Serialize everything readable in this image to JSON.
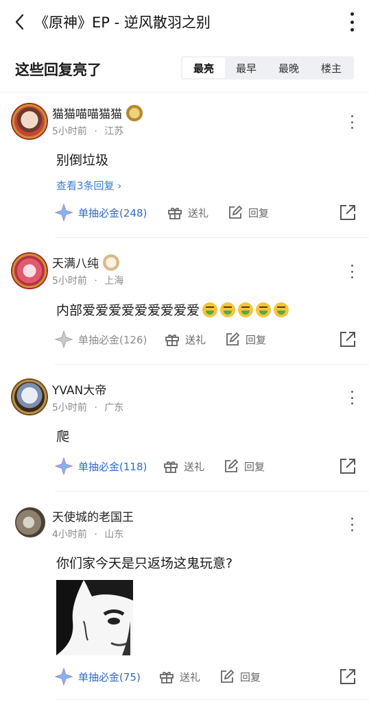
{
  "header": {
    "title": "《原神》EP - 逆风散羽之别"
  },
  "section": {
    "title": "这些回复亮了",
    "sort_tabs": [
      {
        "label": "最亮",
        "active": true
      },
      {
        "label": "最早",
        "active": false
      },
      {
        "label": "最晚",
        "active": false
      },
      {
        "label": "楼主",
        "active": false
      }
    ]
  },
  "comments": [
    {
      "username": "猫猫喵喵猫猫",
      "time": "5小时前",
      "location": "江苏",
      "text": "别倒垃圾",
      "replies_link": "查看3条回复 ›",
      "gold_label": "单抽必金(248)",
      "gift_label": "送礼",
      "reply_label": "回复"
    },
    {
      "username": "天满八纯",
      "time": "5小时前",
      "location": "上海",
      "text": "内部爱爱爱爱爱爱爱爱爱",
      "emoji": "nauseated-face-icon",
      "emoji_count": 5,
      "gold_label": "单抽必金(126)",
      "gift_label": "送礼",
      "reply_label": "回复"
    },
    {
      "username": "YVAN大帝",
      "time": "5小时前",
      "location": "广东",
      "text": "爬",
      "gold_label": "单抽必金(118)",
      "gift_label": "送礼",
      "reply_label": "回复"
    },
    {
      "username": "天使城的老国王",
      "time": "4小时前",
      "location": "山东",
      "text": "你们家今天是只返场这鬼玩意?",
      "gold_label": "单抽必金(75)",
      "gift_label": "送礼",
      "reply_label": "回复"
    }
  ],
  "meta_separator": "·",
  "colors": {
    "link": "#3a7bd5",
    "gold_active": "#2d6bc8",
    "muted": "#8b8b8b"
  }
}
